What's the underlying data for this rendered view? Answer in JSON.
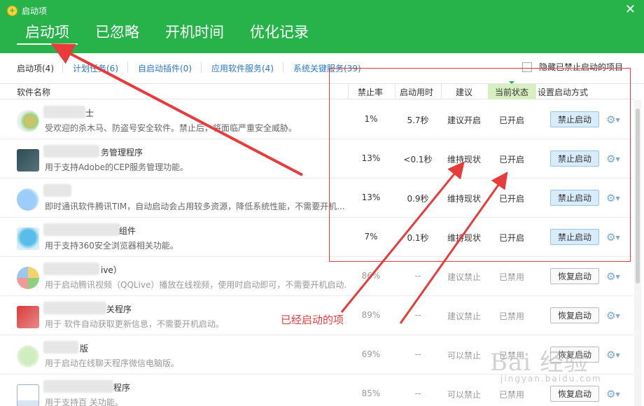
{
  "window": {
    "title": "启动项",
    "close_glyph": "✕"
  },
  "main_tabs": [
    {
      "label": "启动项",
      "active": true
    },
    {
      "label": "已忽略"
    },
    {
      "label": "开机时间"
    },
    {
      "label": "优化记录"
    }
  ],
  "sub_tabs": [
    {
      "label": "启动项(4)",
      "active": true
    },
    {
      "label": "计划任务(6)"
    },
    {
      "label": "自启动插件(0)"
    },
    {
      "label": "应用软件服务(4)"
    },
    {
      "label": "系统关键服务(39)"
    }
  ],
  "hide_disabled": {
    "label": "隐藏已禁止启动的项目",
    "checked": false
  },
  "columns": {
    "name": "软件名称",
    "rate": "禁止率",
    "time": "启动用时",
    "advice": "建议",
    "state": "当前状态",
    "mode": "设置启动方式"
  },
  "rows": [
    {
      "name": "士",
      "desc": "受欢迎的杀木马、防盗号安全软件。禁止后，将面临严重安全威胁。",
      "rate": "1%",
      "time": "5.7秒",
      "advice": "建议开启",
      "state": "已开启",
      "button": "禁止启动",
      "enabled": true
    },
    {
      "name": "务管理程序",
      "desc": "用于支持Adobe的CEP服务管理功能。",
      "rate": "13%",
      "time": "<0.1秒",
      "advice": "维持现状",
      "state": "已开启",
      "button": "禁止启动",
      "enabled": true
    },
    {
      "name": "",
      "desc": "即时通讯软件腾讯TIM，自动启动会占用较多资源，降低系统性能，不需要开机...",
      "rate": "13%",
      "time": "0.9秒",
      "advice": "维持现状",
      "state": "已开启",
      "button": "禁止启动",
      "enabled": true
    },
    {
      "name": "组件",
      "desc": "用于支持360安全浏览器相关功能。",
      "rate": "7%",
      "time": "0.1秒",
      "advice": "维持现状",
      "state": "已开启",
      "button": "禁止启动",
      "enabled": true
    },
    {
      "name": "ive）",
      "desc": "用于启动腾讯视频（QQLive）播放在线视频，使用时启动即可，不需要开机启动...",
      "rate": "86%",
      "time": "--",
      "advice": "建议禁止",
      "state": "已禁用",
      "button": "恢复启动",
      "enabled": false
    },
    {
      "name": "关程序",
      "desc": "用于      软件自动获取更新信息，不需要开机启动。",
      "rate": "89%",
      "time": "--",
      "advice": "建议禁止",
      "state": "已禁用",
      "button": "恢复启动",
      "enabled": false
    },
    {
      "name": "版",
      "desc": "用于启动在线聊天程序微信电脑版。",
      "rate": "69%",
      "time": "--",
      "advice": "可以禁止",
      "state": "已禁用",
      "button": "恢复启动",
      "enabled": false
    },
    {
      "name": "程序",
      "desc": "用于支持百          关功能。",
      "rate": "85%",
      "time": "--",
      "advice": "可以禁止",
      "state": "已禁用",
      "button": "恢复启动",
      "enabled": false
    }
  ],
  "annotation": {
    "text": "已经启动的项",
    "color": "#e63c3c"
  },
  "watermark": {
    "main": "Bai 经验",
    "sub": "jingyan.baidu.com"
  },
  "colors": {
    "brand_green": "#27b34a",
    "link_blue": "#2b79c2",
    "annotation_red": "#e63c3c",
    "button_blue": "#d9ecfb"
  },
  "icons": [
    "app-logo-icon",
    "close-icon",
    "gear-icon",
    "chevron-down-icon",
    "checkbox-icon"
  ]
}
